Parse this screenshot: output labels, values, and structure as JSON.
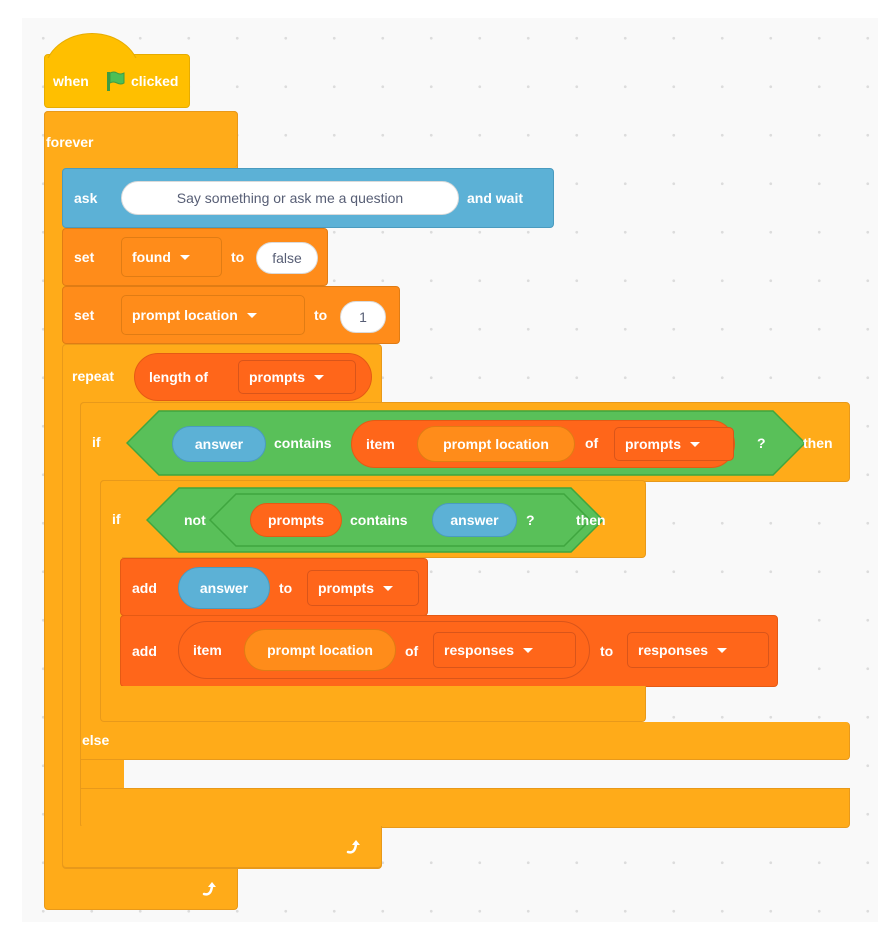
{
  "workspace": {
    "background": "#f9f9f9",
    "colors": {
      "events": "#ffbf00",
      "control": "#ffab19",
      "sensing": "#5cb1d6",
      "variables": "#ff8c1a",
      "lists": "#ff661a",
      "operators": "#59c059",
      "flag": "#4cbf56"
    }
  },
  "script": {
    "hat": {
      "when": "when",
      "icon": "green-flag-icon",
      "clicked": "clicked"
    },
    "forever": {
      "label": "forever",
      "icon": "loop-arrow-icon"
    },
    "ask": {
      "label": "ask",
      "input": "Say something or ask me a question",
      "suffix": "and wait"
    },
    "set_found": {
      "label": "set",
      "variable": "found",
      "to": "to",
      "value": "false"
    },
    "set_prompt_location": {
      "label": "set",
      "variable": "prompt location",
      "to": "to",
      "value": "1"
    },
    "repeat": {
      "label": "repeat",
      "reporter": "length of",
      "list": "prompts",
      "icon": "loop-arrow-icon"
    },
    "if_outer": {
      "label": "if",
      "condition": {
        "left": "answer",
        "op": "contains",
        "item_label": "item",
        "index": "prompt location",
        "of": "of",
        "list": "prompts",
        "q": "?"
      },
      "then": "then",
      "else": "else"
    },
    "if_inner": {
      "label": "if",
      "not": "not",
      "condition": {
        "left": "prompts",
        "op": "contains",
        "right": "answer",
        "q": "?"
      },
      "then": "then"
    },
    "add_answer": {
      "label": "add",
      "value": "answer",
      "to": "to",
      "list": "prompts"
    },
    "add_response": {
      "label": "add",
      "item_label": "item",
      "index": "prompt location",
      "of": "of",
      "source_list": "responses",
      "to": "to",
      "list": "responses"
    }
  }
}
